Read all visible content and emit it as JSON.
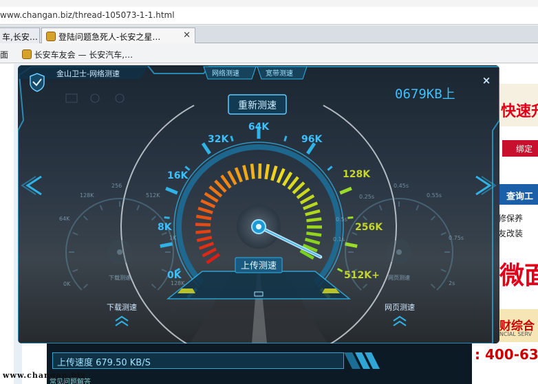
{
  "browser": {
    "address": "www.changan.biz/thread-105073-1-1.html",
    "tabs": [
      {
        "label": "车,长安…"
      },
      {
        "label": "登陆问题急死人-长安之星…",
        "active": true
      }
    ],
    "tab_close": "✕",
    "bookmarks": [
      "面",
      "长安车友会 — 长安汽车,…"
    ]
  },
  "webpage": {
    "ad_top": "快速升",
    "ad_bind": "绑定",
    "ad_query": "查询工",
    "side_links": [
      "修保养",
      "友改装"
    ],
    "ad_big": "微面",
    "ad_combo": "财综合",
    "ad_combo_sub": "NCIAL SERV",
    "phone": ": 400-63",
    "upload_bar": "上传速度   679.50 KB/S",
    "watermark": "www.changan.biz",
    "watermark_sub": "常见问题解答"
  },
  "speedtest": {
    "app_title": "金山卫士-网络测速",
    "tabs": [
      "网络测速",
      "宽带测速"
    ],
    "readout": "0679KB上",
    "retest_button": "重新测速",
    "close_icon": "×",
    "main_gauge": {
      "label": "上传测速",
      "ticks": [
        "0K",
        "8K",
        "16K",
        "32K",
        "64K",
        "96K",
        "128K",
        "256K",
        "512K+"
      ],
      "value_fraction": 0.93
    },
    "left_gauge": {
      "label": "下载测速",
      "ticks": [
        "0K",
        "64K",
        "128K",
        "256",
        "512K",
        "1K",
        "128K"
      ]
    },
    "right_gauge": {
      "label": "网页测速",
      "ticks": [
        "0.25s",
        "0.45s",
        "0.55s",
        "0.75s",
        "0.1s",
        "0.5s",
        "2s"
      ]
    },
    "bottom_labels": {
      "left": "下载测速",
      "right": "网页测速"
    },
    "colors": {
      "accent": "#2fb2e6",
      "tick_text": "#3cc0ff",
      "green": "#9bdc2a",
      "panel": "#0d1d2a"
    }
  }
}
